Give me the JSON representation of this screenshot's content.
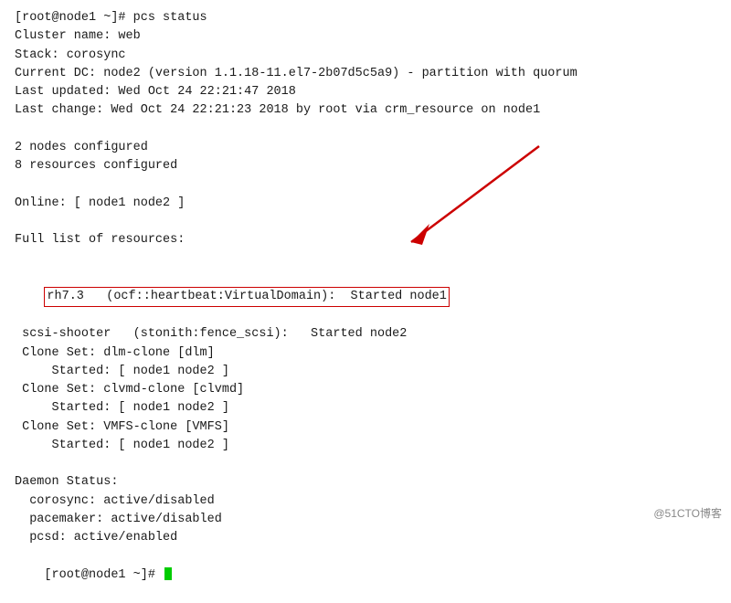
{
  "terminal": {
    "lines": [
      {
        "id": "l1",
        "text": "[root@node1 ~]# pcs status"
      },
      {
        "id": "l2",
        "text": "Cluster name: web"
      },
      {
        "id": "l3",
        "text": "Stack: corosync"
      },
      {
        "id": "l4",
        "text": "Current DC: node2 (version 1.1.18-11.el7-2b07d5c5a9) - partition with quorum"
      },
      {
        "id": "l5",
        "text": "Last updated: Wed Oct 24 22:21:47 2018"
      },
      {
        "id": "l6",
        "text": "Last change: Wed Oct 24 22:21:23 2018 by root via crm_resource on node1"
      },
      {
        "id": "l7",
        "text": ""
      },
      {
        "id": "l8",
        "text": "2 nodes configured"
      },
      {
        "id": "l9",
        "text": "8 resources configured"
      },
      {
        "id": "l10",
        "text": ""
      },
      {
        "id": "l11",
        "text": "Online: [ node1 node2 ]"
      },
      {
        "id": "l12",
        "text": ""
      },
      {
        "id": "l13",
        "text": "Full list of resources:"
      },
      {
        "id": "l14",
        "text": ""
      },
      {
        "id": "l15_highlighted",
        "text": "rh7.3   (ocf::heartbeat:VirtualDomain):  Started node1"
      },
      {
        "id": "l16",
        "text": " scsi-shooter   (stonith:fence_scsi):   Started node2"
      },
      {
        "id": "l17",
        "text": " Clone Set: dlm-clone [dlm]"
      },
      {
        "id": "l18",
        "text": "     Started: [ node1 node2 ]"
      },
      {
        "id": "l19",
        "text": " Clone Set: clvmd-clone [clvmd]"
      },
      {
        "id": "l20",
        "text": "     Started: [ node1 node2 ]"
      },
      {
        "id": "l21",
        "text": " Clone Set: VMFS-clone [VMFS]"
      },
      {
        "id": "l22",
        "text": "     Started: [ node1 node2 ]"
      },
      {
        "id": "l23",
        "text": ""
      },
      {
        "id": "l24",
        "text": "Daemon Status:"
      },
      {
        "id": "l25",
        "text": "  corosync: active/disabled"
      },
      {
        "id": "l26",
        "text": "  pacemaker: active/disabled"
      },
      {
        "id": "l27",
        "text": "  pcsd: active/enabled"
      },
      {
        "id": "l28_prompt",
        "text": "[root@node1 ~]# "
      }
    ],
    "watermark": "@51CTO博客"
  }
}
